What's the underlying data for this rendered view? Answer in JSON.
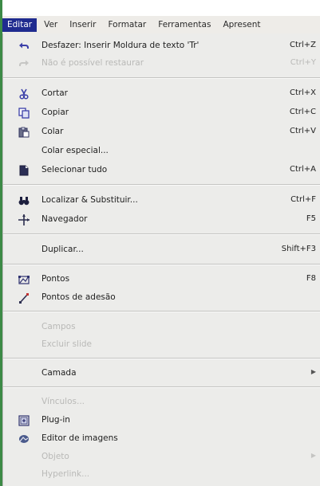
{
  "menubar": {
    "items": [
      {
        "label": "Editar"
      },
      {
        "label": "Ver"
      },
      {
        "label": "Inserir"
      },
      {
        "label": "Formatar"
      },
      {
        "label": "Ferramentas"
      },
      {
        "label": "Apresent"
      }
    ]
  },
  "menu": {
    "items": [
      {
        "label": "Desfazer: Inserir Moldura de texto 'Tr'",
        "shortcut": "Ctrl+Z",
        "icon": "undo-icon",
        "enabled": true
      },
      {
        "label": "Não é possível restaurar",
        "shortcut": "Ctrl+Y",
        "icon": "redo-icon",
        "enabled": false
      },
      {
        "label": "Cortar",
        "shortcut": "Ctrl+X",
        "icon": "scissors-icon",
        "enabled": true
      },
      {
        "label": "Copiar",
        "shortcut": "Ctrl+C",
        "icon": "copy-icon",
        "enabled": true
      },
      {
        "label": "Colar",
        "shortcut": "Ctrl+V",
        "icon": "paste-icon",
        "enabled": true
      },
      {
        "label": "Colar especial...",
        "shortcut": "",
        "icon": "",
        "enabled": true
      },
      {
        "label": "Selecionar tudo",
        "shortcut": "Ctrl+A",
        "icon": "select-all-icon",
        "enabled": true
      },
      {
        "label": "Localizar & Substituir...",
        "shortcut": "Ctrl+F",
        "icon": "binoculars-icon",
        "enabled": true
      },
      {
        "label": "Navegador",
        "shortcut": "F5",
        "icon": "navigator-icon",
        "enabled": true
      },
      {
        "label": "Duplicar...",
        "shortcut": "Shift+F3",
        "icon": "",
        "enabled": true
      },
      {
        "label": "Pontos",
        "shortcut": "F8",
        "icon": "points-icon",
        "enabled": true
      },
      {
        "label": "Pontos de adesão",
        "shortcut": "",
        "icon": "glue-points-icon",
        "enabled": true
      },
      {
        "label": "Campos",
        "shortcut": "",
        "icon": "",
        "enabled": false
      },
      {
        "label": "Excluir slide",
        "shortcut": "",
        "icon": "",
        "enabled": false
      },
      {
        "label": "Camada",
        "shortcut": "",
        "icon": "",
        "enabled": true,
        "submenu": true
      },
      {
        "label": "Vínculos...",
        "shortcut": "",
        "icon": "",
        "enabled": false
      },
      {
        "label": "Plug-in",
        "shortcut": "",
        "icon": "plugin-icon",
        "enabled": true
      },
      {
        "label": "Editor de imagens",
        "shortcut": "",
        "icon": "image-map-icon",
        "enabled": true
      },
      {
        "label": "Objeto",
        "shortcut": "",
        "icon": "",
        "enabled": false,
        "submenu": true
      },
      {
        "label": "Hyperlink...",
        "shortcut": "",
        "icon": "",
        "enabled": false
      }
    ]
  },
  "colors": {
    "menu_bg": "#ececea",
    "active_menu": "#1f2b8f",
    "disabled_text": "#b9b9b7",
    "left_strip": "#3c8a46"
  }
}
